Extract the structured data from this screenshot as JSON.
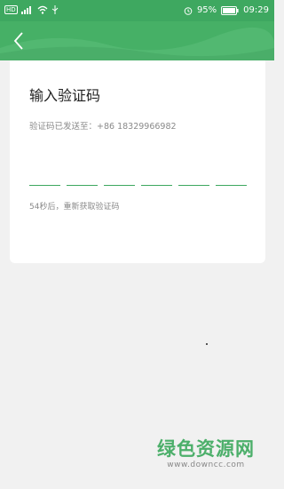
{
  "status_bar": {
    "left_icons": [
      "hd-icon",
      "signal-icon",
      "wifi-icon",
      "usb-icon"
    ],
    "hd_label": "HD",
    "battery": "95%",
    "time": "09:29"
  },
  "header": {
    "back_icon": "chevron-left-icon"
  },
  "verify": {
    "title": "输入验证码",
    "sent_prefix": "验证码已发送至：",
    "phone": "+86 18329966982",
    "code_slots": 6,
    "resend": "54秒后，重新获取验证码"
  },
  "watermark": {
    "title": "绿色资源网",
    "url": "www.downcc.com"
  },
  "colors": {
    "accent": "#3ea860",
    "background": "#f1f1f1"
  }
}
